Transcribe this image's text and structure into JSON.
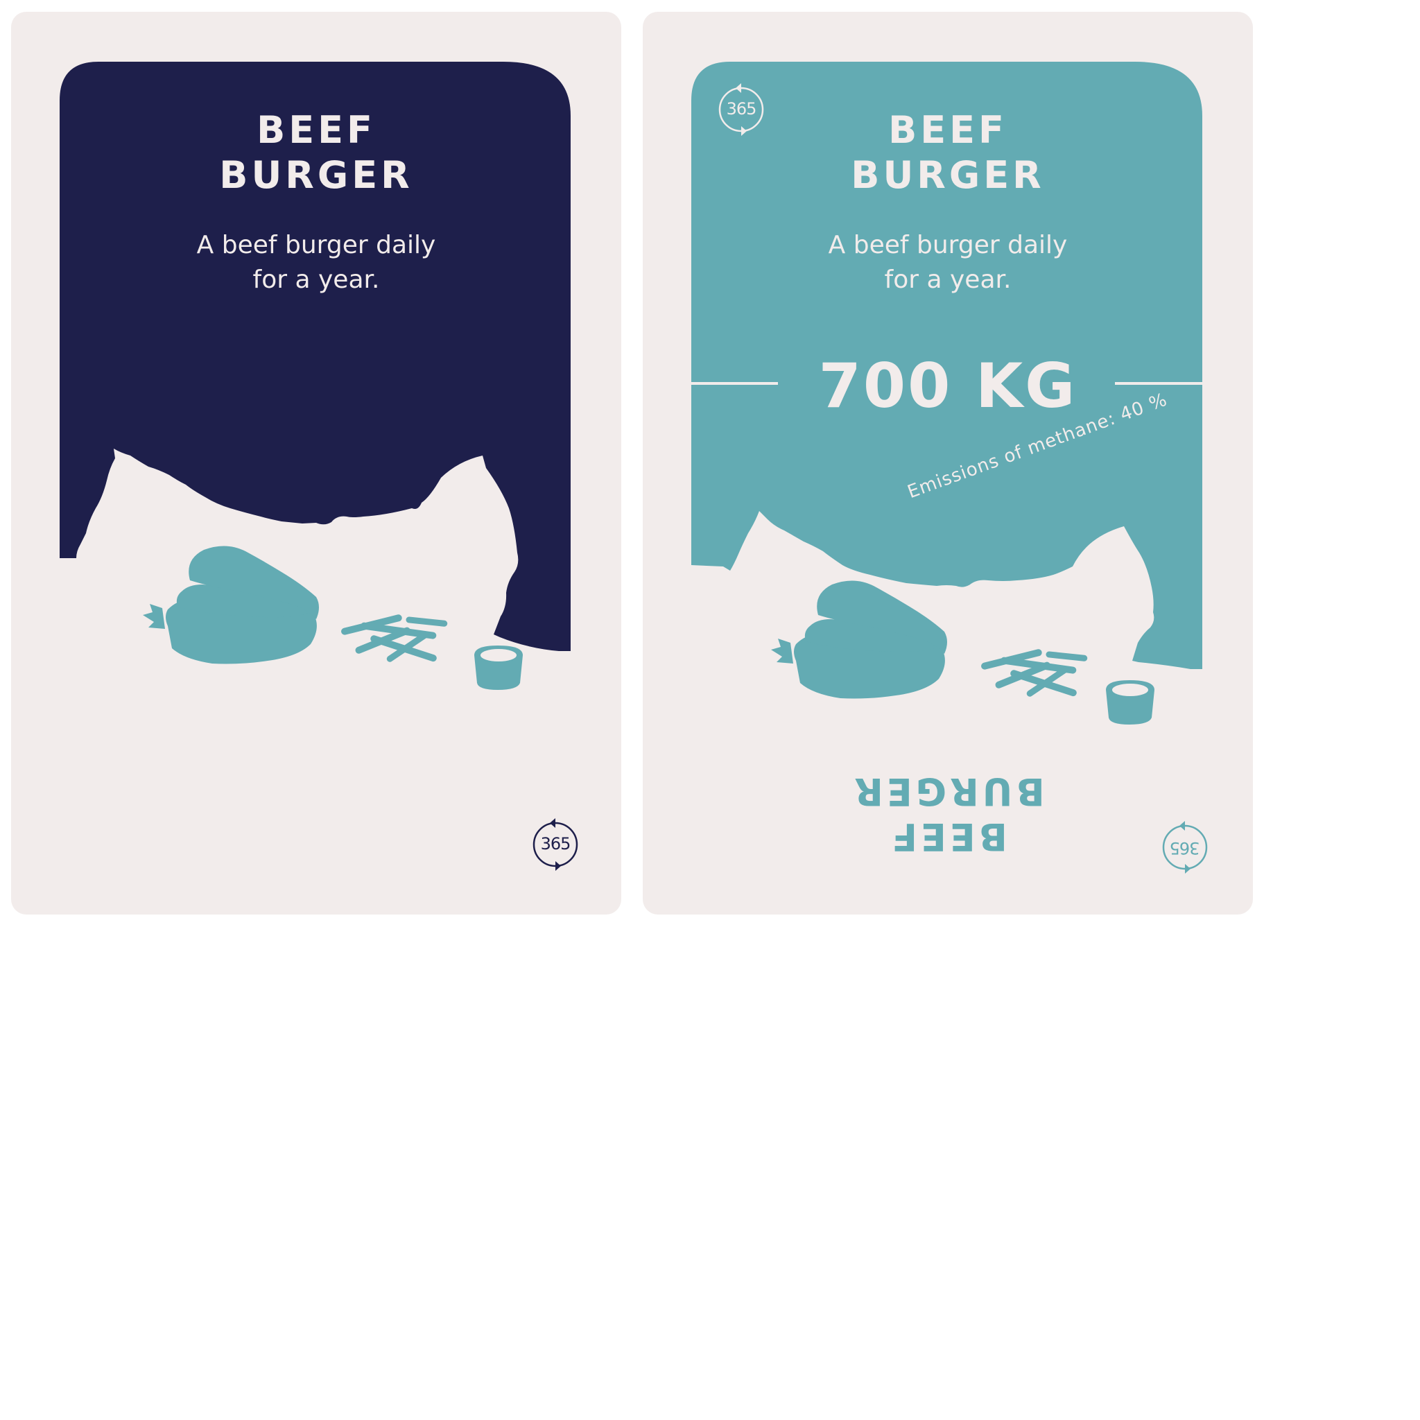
{
  "colors": {
    "navy": "#1e1f4b",
    "teal": "#63abb3",
    "cream": "#f2eceb"
  },
  "cards": {
    "front": {
      "title_line1": "BEEF",
      "title_line2": "BURGER",
      "subtitle_line1": "A beef burger daily",
      "subtitle_line2": "for a year.",
      "badge_number": "365",
      "icons": [
        "burger-icon",
        "fries-icon",
        "dip-cup-icon",
        "cycle-365-icon"
      ]
    },
    "back": {
      "title_line1": "BEEF",
      "title_line2": "BURGER",
      "subtitle_line1": "A beef burger daily",
      "subtitle_line2": "for a year.",
      "amount": "700 KG",
      "methane_note": "Emissions of methane: 40 %",
      "badge_number_top": "365",
      "badge_number_bottom": "365",
      "flipped_title_line1": "BEEF",
      "flipped_title_line2": "BURGER",
      "icons": [
        "burger-icon",
        "fries-icon",
        "dip-cup-icon",
        "cycle-365-icon"
      ]
    }
  }
}
